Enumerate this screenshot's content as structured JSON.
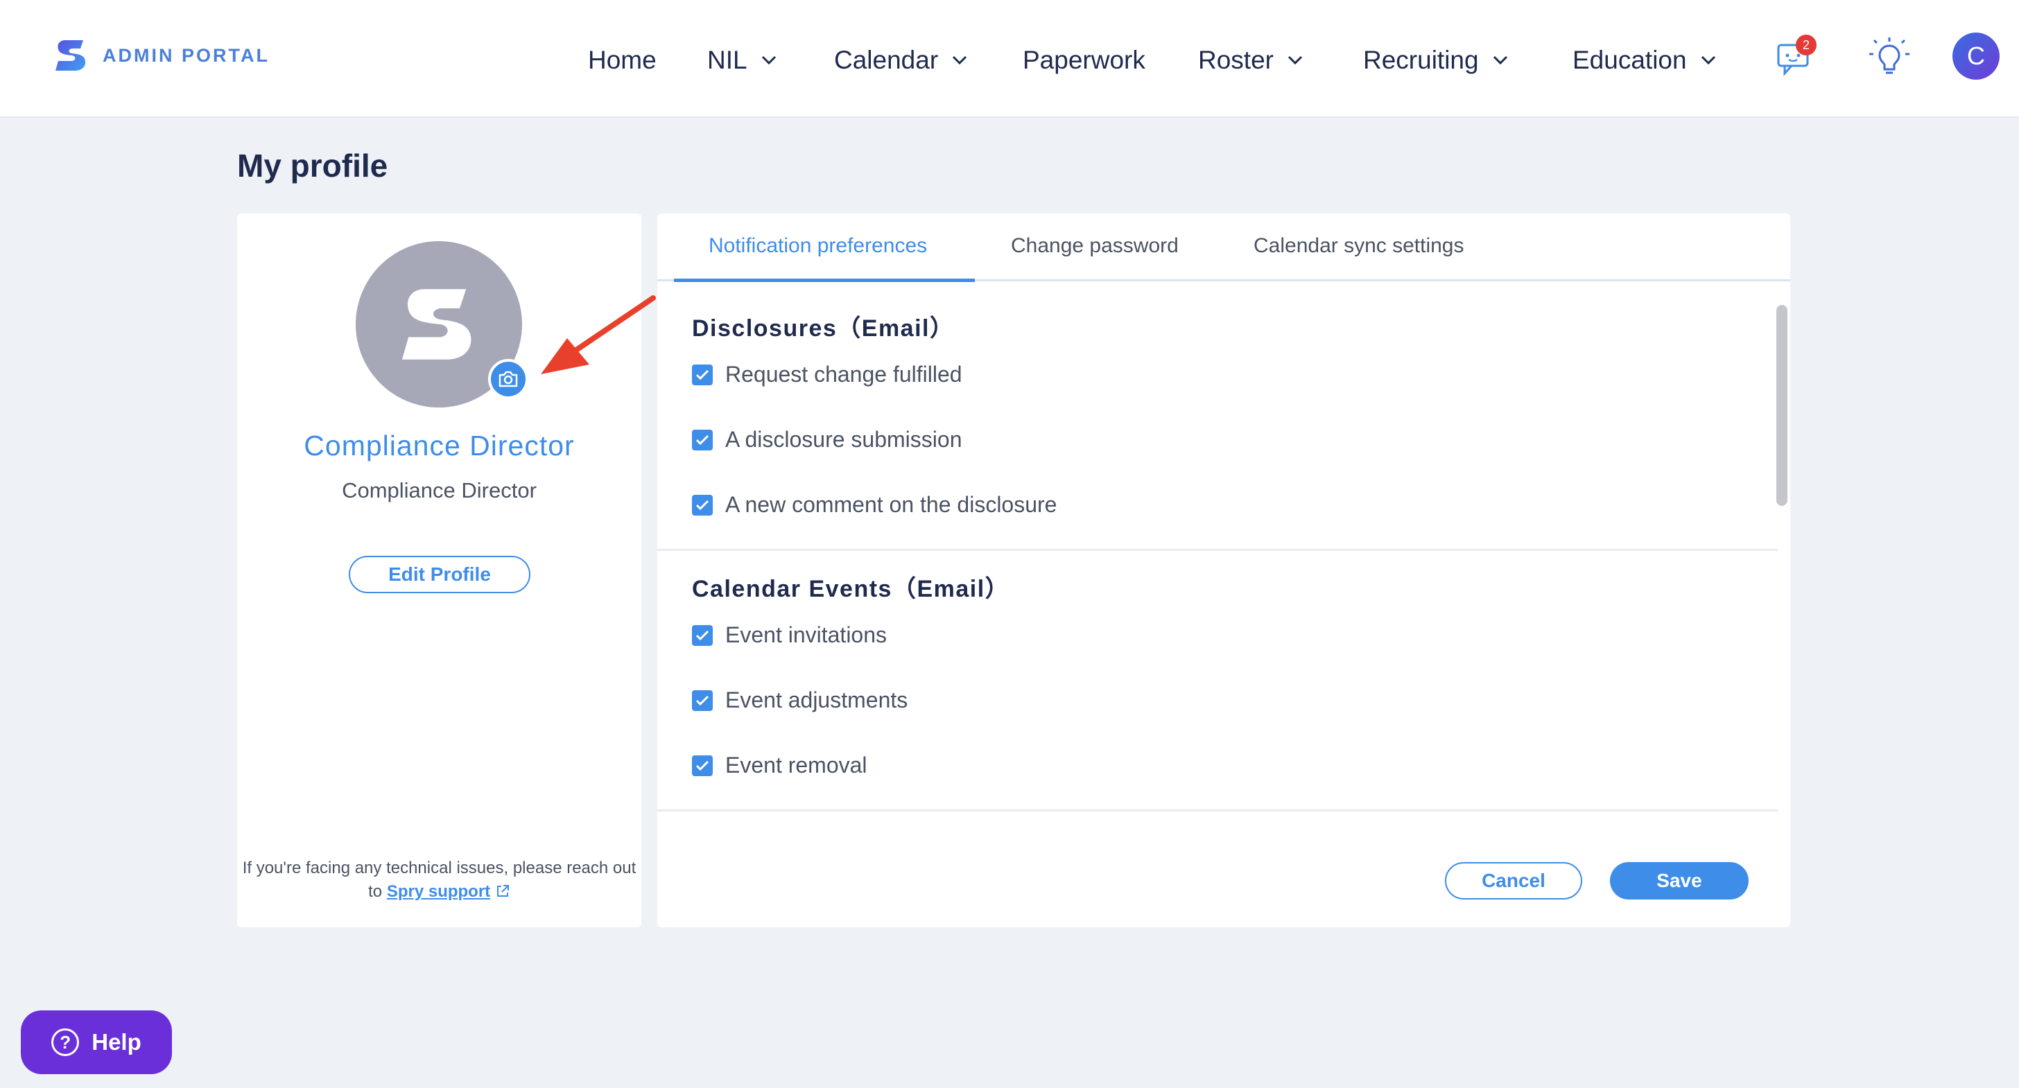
{
  "brand": {
    "name": "ADMIN PORTAL",
    "logo_icon": "spry-logo-icon"
  },
  "nav": {
    "items": [
      {
        "label": "Home",
        "has_dropdown": false
      },
      {
        "label": "NIL",
        "has_dropdown": true
      },
      {
        "label": "Calendar",
        "has_dropdown": true
      },
      {
        "label": "Paperwork",
        "has_dropdown": false
      },
      {
        "label": "Roster",
        "has_dropdown": true
      },
      {
        "label": "Recruiting",
        "has_dropdown": true
      },
      {
        "label": "Education",
        "has_dropdown": true
      }
    ],
    "messages_badge": "2",
    "user_initial": "C"
  },
  "page": {
    "title": "My profile"
  },
  "profile": {
    "name": "Compliance Director",
    "role": "Compliance Director",
    "edit_label": "Edit Profile",
    "support_text": "If you're facing any technical issues, please reach out to",
    "support_link": "Spry support"
  },
  "tabs": [
    {
      "label": "Notification preferences",
      "active": true
    },
    {
      "label": "Change password",
      "active": false
    },
    {
      "label": "Calendar sync settings",
      "active": false
    }
  ],
  "sections": [
    {
      "title": "Disclosures（Email）",
      "items": [
        {
          "label": "Request change fulfilled",
          "checked": true
        },
        {
          "label": "A disclosure submission",
          "checked": true
        },
        {
          "label": "A new comment on the disclosure",
          "checked": true
        }
      ]
    },
    {
      "title": "Calendar Events（Email）",
      "items": [
        {
          "label": "Event invitations",
          "checked": true
        },
        {
          "label": "Event adjustments",
          "checked": true
        },
        {
          "label": "Event removal",
          "checked": true
        }
      ]
    }
  ],
  "actions": {
    "cancel_label": "Cancel",
    "save_label": "Save"
  },
  "help": {
    "label": "Help"
  },
  "colors": {
    "accent": "#3e8de9",
    "help": "#6a2fd8",
    "annotation": "#e8402a",
    "badge": "#e53935"
  }
}
